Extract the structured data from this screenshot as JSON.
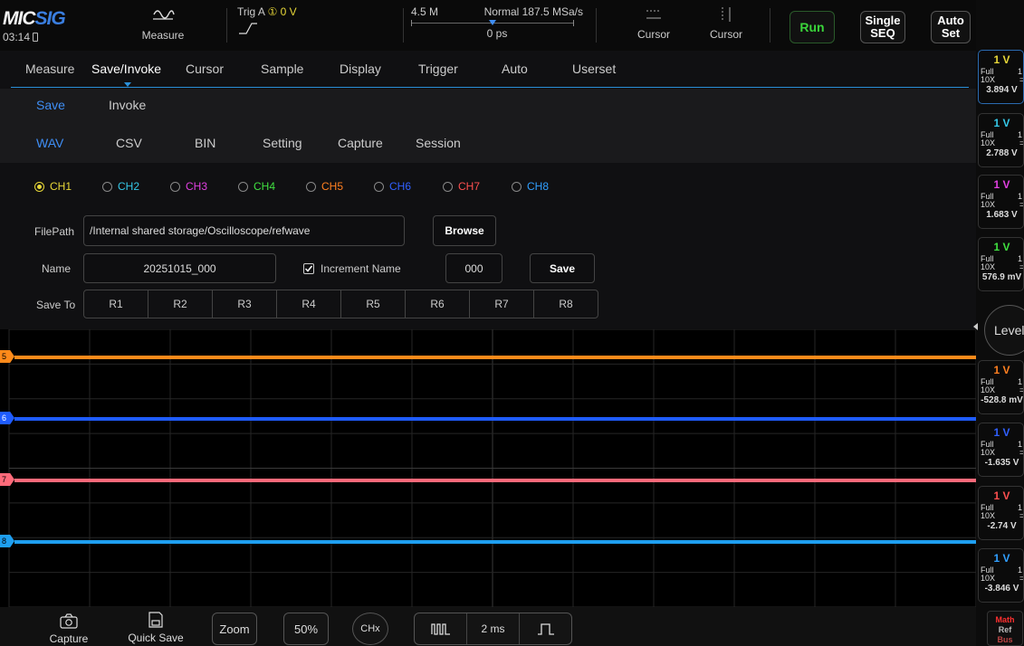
{
  "app": {
    "logo_a": "MIC",
    "logo_b": "SIG",
    "clock": "03:14"
  },
  "topbar": {
    "measure_label": "Measure",
    "trigger": {
      "source": "Trig A",
      "level": "① 0 V"
    },
    "timebase": {
      "depth": "4.5 M",
      "mode_rate": "Normal 187.5 MSa/s",
      "offset": "0 ps"
    },
    "cursor1_label": "Cursor",
    "cursor2_label": "Cursor",
    "run_label": "Run",
    "single_label_1": "Single",
    "single_label_2": "SEQ",
    "auto_label_1": "Auto",
    "auto_label_2": "Set"
  },
  "menu": {
    "items": [
      "Measure",
      "Save/Invoke",
      "Cursor",
      "Sample",
      "Display",
      "Trigger",
      "Auto",
      "Userset"
    ],
    "active": "Save/Invoke"
  },
  "submenu": {
    "row1": [
      "Save",
      "Invoke"
    ],
    "row2": [
      "WAV",
      "CSV",
      "BIN",
      "Setting",
      "Capture",
      "Session"
    ]
  },
  "channels": [
    {
      "name": "CH1",
      "color": "#e8d838",
      "selected": true
    },
    {
      "name": "CH2",
      "color": "#35c8e8",
      "selected": false
    },
    {
      "name": "CH3",
      "color": "#e040e0",
      "selected": false
    },
    {
      "name": "CH4",
      "color": "#40e040",
      "selected": false
    },
    {
      "name": "CH5",
      "color": "#ff8020",
      "selected": false
    },
    {
      "name": "CH6",
      "color": "#3060ff",
      "selected": false
    },
    {
      "name": "CH7",
      "color": "#ff5050",
      "selected": false
    },
    {
      "name": "CH8",
      "color": "#30a0ff",
      "selected": false
    }
  ],
  "form": {
    "filepath_label": "FilePath",
    "filepath_value": "/Internal shared storage/Oscilloscope/refwave",
    "browse_label": "Browse",
    "name_label": "Name",
    "name_value": "20251015_000",
    "increment_label": "Increment Name",
    "increment_checked": true,
    "increment_value": "000",
    "save_label": "Save",
    "saveto_label": "Save To",
    "refs": [
      "R1",
      "R2",
      "R3",
      "R4",
      "R5",
      "R6",
      "R7",
      "R8"
    ]
  },
  "waveforms": [
    {
      "marker": "5",
      "color": "#ff8a1a"
    },
    {
      "marker": "6",
      "color": "#1f5cff"
    },
    {
      "marker": "7",
      "color": "#ff6a7a"
    },
    {
      "marker": "8",
      "color": "#1e9ff0"
    }
  ],
  "right_panel": {
    "boxes": [
      {
        "scale": "1 V",
        "color": "#e8d838",
        "full": "Full",
        "probe": "10X",
        "offset": "3.894 V"
      },
      {
        "scale": "1 V",
        "color": "#35c8e8",
        "full": "Full",
        "probe": "10X",
        "offset": "2.788 V"
      },
      {
        "scale": "1 V",
        "color": "#e040e0",
        "full": "Full",
        "probe": "10X",
        "offset": "1.683 V"
      },
      {
        "scale": "1 V",
        "color": "#40e040",
        "full": "Full",
        "probe": "10X",
        "offset": "576.9 mV"
      },
      {
        "scale": "1 V",
        "color": "#ff8020",
        "full": "Full",
        "probe": "10X",
        "offset": "-528.8 mV"
      },
      {
        "scale": "1 V",
        "color": "#3060ff",
        "full": "Full",
        "probe": "10X",
        "offset": "-1.635 V"
      },
      {
        "scale": "1 V",
        "color": "#ff5050",
        "full": "Full",
        "probe": "10X",
        "offset": "-2.74 V"
      },
      {
        "scale": "1 V",
        "color": "#30a0ff",
        "full": "Full",
        "probe": "10X",
        "offset": "-3.846 V"
      }
    ],
    "level_label": "Level",
    "math_label": "Math",
    "ref_label": "Ref",
    "bus_label": "Bus"
  },
  "bottombar": {
    "capture_label": "Capture",
    "quicksave_label": "Quick Save",
    "zoom_label": "Zoom",
    "percent_label": "50%",
    "chx_label": "CHx",
    "timebase_label": "2 ms"
  }
}
